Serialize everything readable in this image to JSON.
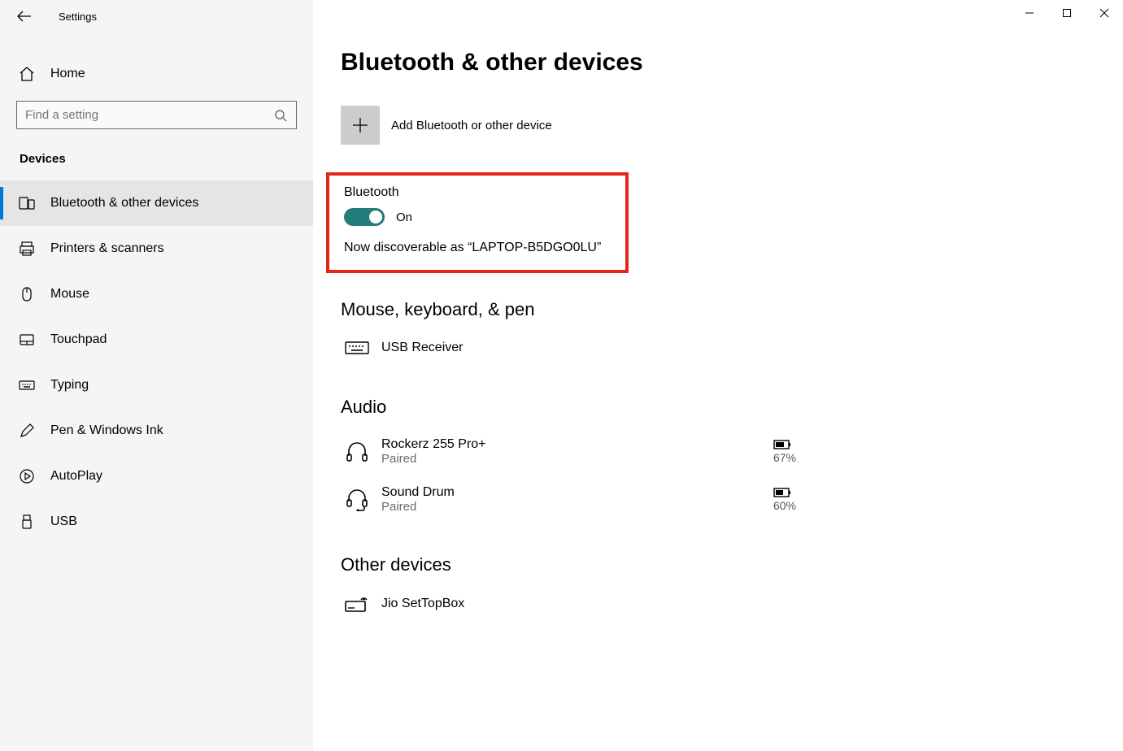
{
  "app_title": "Settings",
  "home_label": "Home",
  "search_placeholder": "Find a setting",
  "category_header": "Devices",
  "sidebar_items": [
    {
      "label": "Bluetooth & other devices",
      "active": true
    },
    {
      "label": "Printers & scanners",
      "active": false
    },
    {
      "label": "Mouse",
      "active": false
    },
    {
      "label": "Touchpad",
      "active": false
    },
    {
      "label": "Typing",
      "active": false
    },
    {
      "label": "Pen & Windows Ink",
      "active": false
    },
    {
      "label": "AutoPlay",
      "active": false
    },
    {
      "label": "USB",
      "active": false
    }
  ],
  "page_title": "Bluetooth & other devices",
  "add_device_label": "Add Bluetooth or other device",
  "bluetooth": {
    "label": "Bluetooth",
    "status": "On",
    "discoverable": "Now discoverable as “LAPTOP-B5DGO0LU”"
  },
  "sections": {
    "mouse_keyboard_pen": {
      "title": "Mouse, keyboard, & pen",
      "devices": [
        {
          "name": "USB Receiver",
          "status": "",
          "battery": ""
        }
      ]
    },
    "audio": {
      "title": "Audio",
      "devices": [
        {
          "name": "Rockerz 255 Pro+",
          "status": "Paired",
          "battery": "67%"
        },
        {
          "name": "Sound Drum",
          "status": "Paired",
          "battery": "60%"
        }
      ]
    },
    "other": {
      "title": "Other devices",
      "devices": [
        {
          "name": "Jio SetTopBox",
          "status": "",
          "battery": ""
        }
      ]
    }
  }
}
